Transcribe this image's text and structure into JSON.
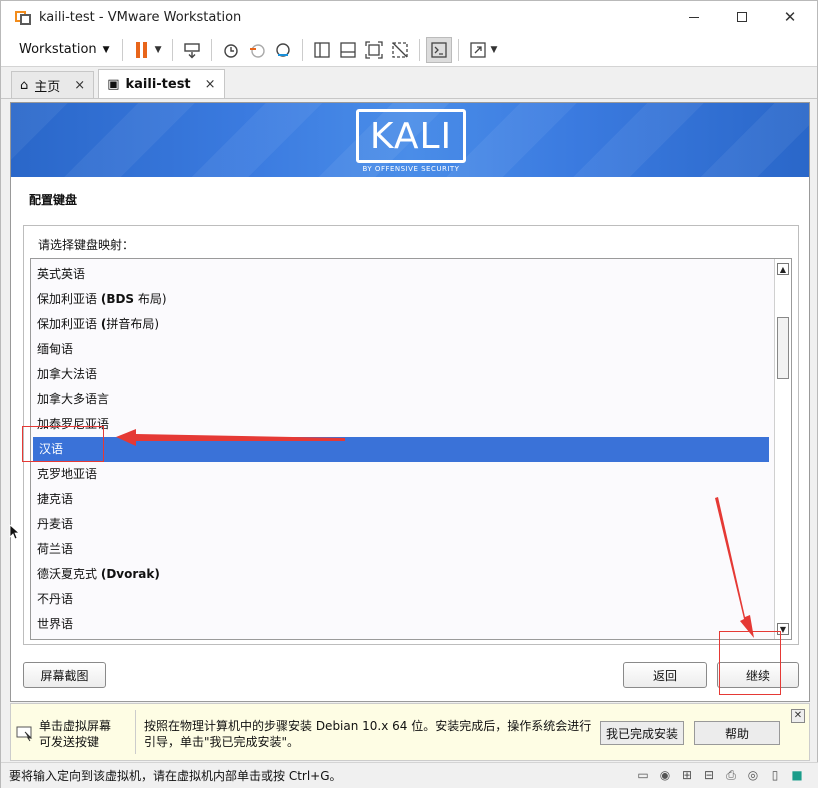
{
  "window": {
    "title": "kaili-test - VMware Workstation"
  },
  "toolbar": {
    "menu_label": "Workstation"
  },
  "tabs": [
    {
      "label": "主页",
      "icon": "home-icon"
    },
    {
      "label": "kaili-test",
      "icon": "vm-icon"
    }
  ],
  "installer": {
    "brand": "KALI",
    "brand_sub": "BY OFFENSIVE SECURITY",
    "section_title": "配置键盘",
    "prompt": "请选择键盘映射：",
    "items": [
      {
        "prefix": "英式英语",
        "bold": "",
        "suffix": ""
      },
      {
        "prefix": "保加利亚语 ",
        "bold": "(BDS",
        "suffix": " 布局)"
      },
      {
        "prefix": "保加利亚语 ",
        "bold": "(",
        "suffix": "拼音布局)"
      },
      {
        "prefix": "缅甸语",
        "bold": "",
        "suffix": ""
      },
      {
        "prefix": "加拿大法语",
        "bold": "",
        "suffix": ""
      },
      {
        "prefix": "加拿大多语言",
        "bold": "",
        "suffix": ""
      },
      {
        "prefix": "加泰罗尼亚语",
        "bold": "",
        "suffix": ""
      },
      {
        "prefix": "汉语",
        "bold": "",
        "suffix": ""
      },
      {
        "prefix": "克罗地亚语",
        "bold": "",
        "suffix": ""
      },
      {
        "prefix": "捷克语",
        "bold": "",
        "suffix": ""
      },
      {
        "prefix": "丹麦语",
        "bold": "",
        "suffix": ""
      },
      {
        "prefix": "荷兰语",
        "bold": "",
        "suffix": ""
      },
      {
        "prefix": "德沃夏克式 ",
        "bold": "(Dvorak)",
        "suffix": ""
      },
      {
        "prefix": "不丹语",
        "bold": "",
        "suffix": ""
      },
      {
        "prefix": "世界语",
        "bold": "",
        "suffix": ""
      }
    ],
    "selected_item": "汉语",
    "buttons": {
      "screenshot": "屏幕截图",
      "back": "返回",
      "continue": "继续"
    }
  },
  "hint": {
    "left_line1": "单击虚拟屏幕",
    "left_line2": "可发送按键",
    "main_line1": "按照在物理计算机中的步骤安装 Debian 10.x 64 位。安装完成后，操作系统会进行",
    "main_line2": "引导，单击\"我已完成安装\"。",
    "done_button": "我已完成安装",
    "help_button": "帮助"
  },
  "status": {
    "text": "要将输入定向到该虚拟机，请在虚拟机内部单击或按 Ctrl+G。"
  },
  "colors": {
    "selection": "#3a72d8",
    "pause_icon": "#e8651a",
    "annotation": "#e53935",
    "hint_background": "#fefde4"
  }
}
